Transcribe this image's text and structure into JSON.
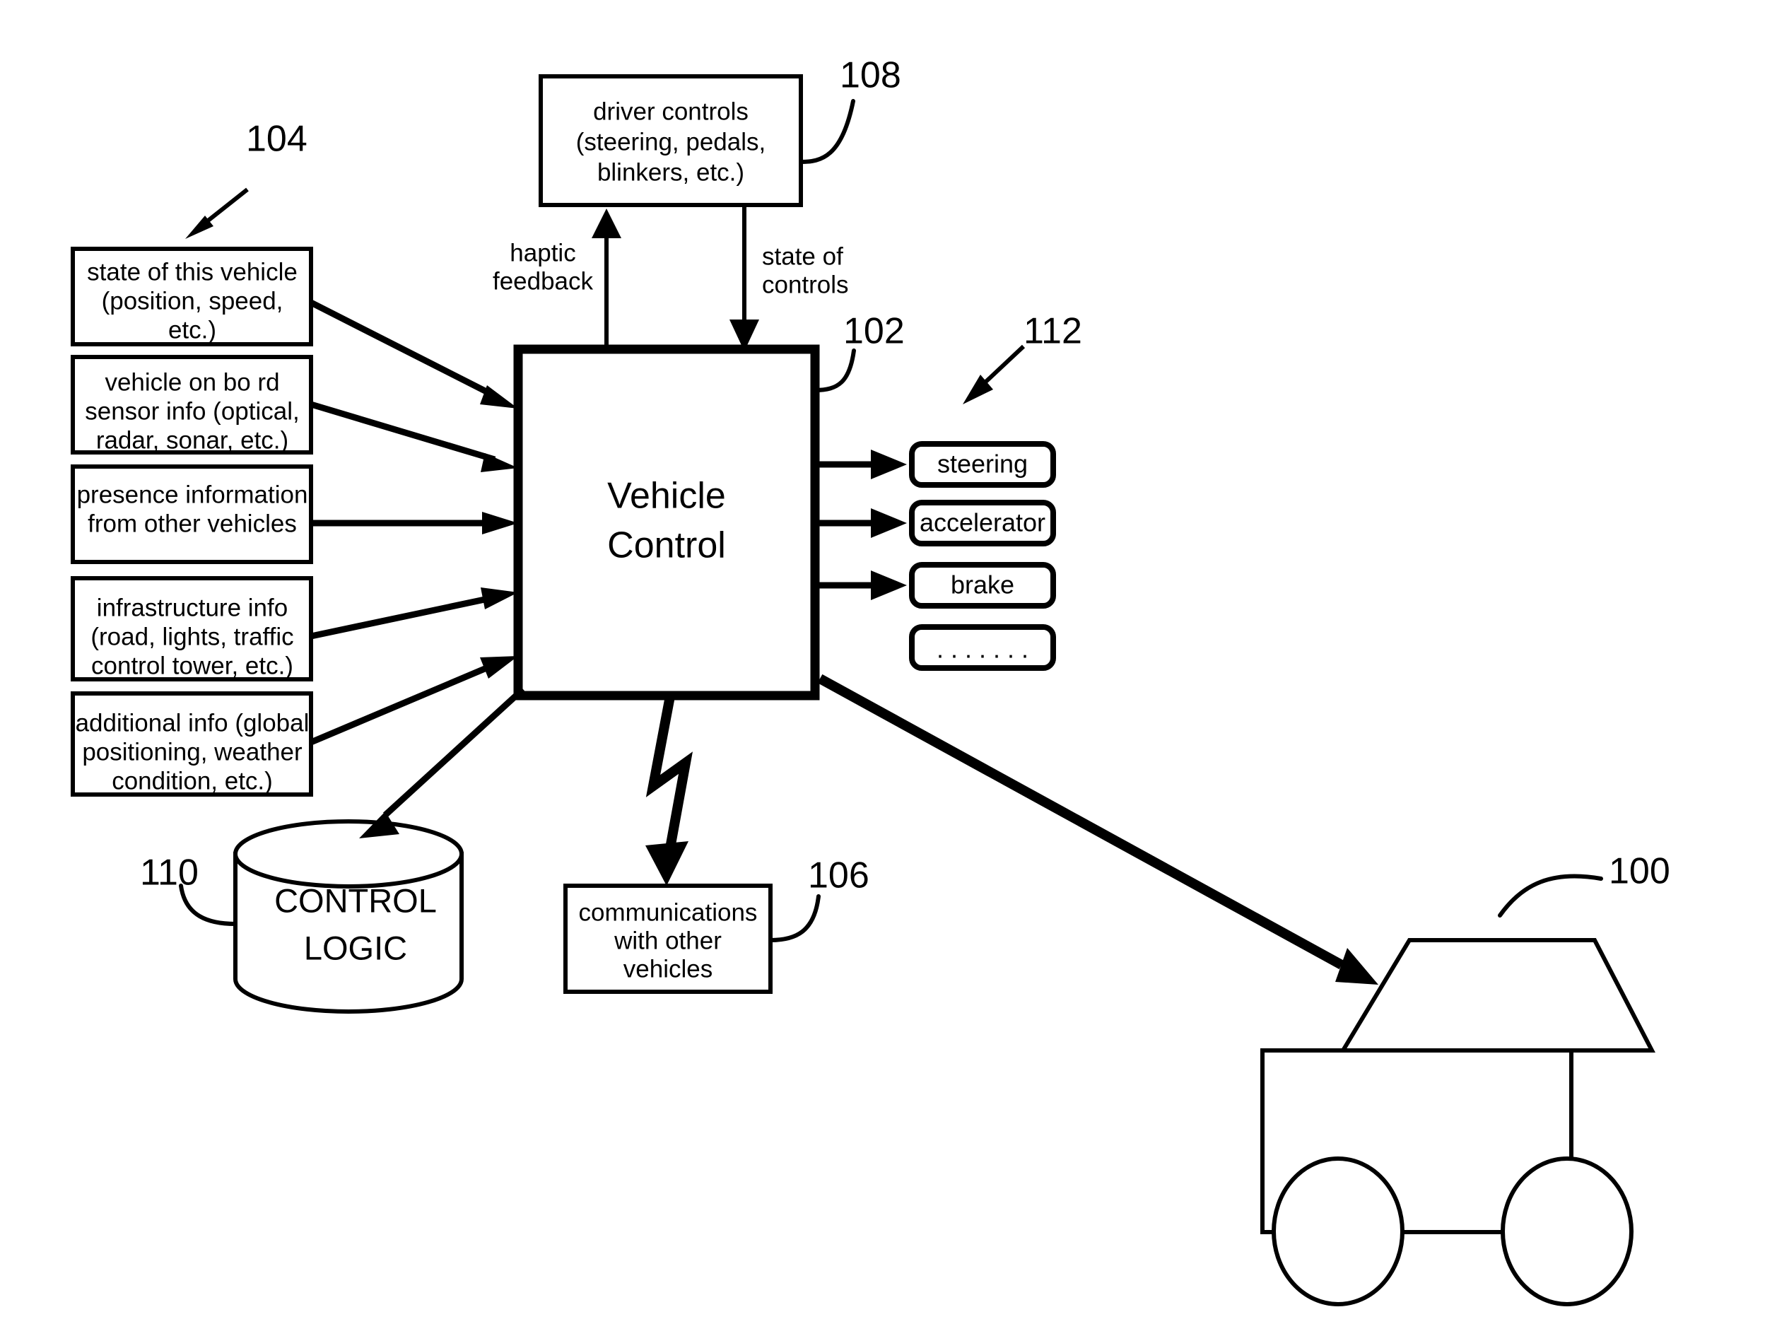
{
  "figure": {
    "title": "Vehicle Control System Block Diagram",
    "center_block": {
      "label_line_1": "Vehicle",
      "label_line_2": "Control",
      "ref": "102"
    },
    "inputs": {
      "group_ref": "104",
      "items": [
        {
          "name": "state-of-vehicle",
          "lines": [
            "state of this vehicle",
            "(position, speed,",
            "etc.)"
          ]
        },
        {
          "name": "onboard-sensor-info",
          "lines": [
            "vehicle on  bo  rd",
            "sensor info (optical,",
            "radar, sonar, etc.)"
          ]
        },
        {
          "name": "presence-information",
          "lines": [
            "presence information",
            "from other vehicles"
          ]
        },
        {
          "name": "infrastructure-info",
          "lines": [
            "infrastructure info",
            "(road, lights, traffic",
            "control tower, etc.)"
          ]
        },
        {
          "name": "additional-info",
          "lines": [
            "additional info (global",
            "positioning, weather",
            "condition, etc.)"
          ]
        }
      ]
    },
    "driver_controls": {
      "ref": "108",
      "lines": [
        "driver controls",
        "(steering, pedals,",
        "blinkers, etc.)"
      ]
    },
    "edge_labels": {
      "haptic": [
        "haptic",
        "feedback"
      ],
      "state_of_controls": [
        "state of",
        "controls"
      ]
    },
    "outputs": {
      "group_ref": "112",
      "items": [
        {
          "name": "steering",
          "label": "steering",
          "has_arrow": true
        },
        {
          "name": "accelerator",
          "label": "accelerator",
          "has_arrow": true
        },
        {
          "name": "brake",
          "label": "brake",
          "has_arrow": true
        },
        {
          "name": "ellipsis",
          "label": ". . . . . . .",
          "has_arrow": false
        }
      ]
    },
    "control_logic": {
      "ref": "110",
      "lines": [
        "CONTROL",
        "LOGIC"
      ]
    },
    "communications": {
      "ref": "106",
      "lines": [
        "communications",
        "with other",
        "vehicles"
      ]
    },
    "vehicle": {
      "ref": "100",
      "name": "car-illustration"
    },
    "colors": {
      "ink": "#000000",
      "paper": "#ffffff"
    }
  }
}
